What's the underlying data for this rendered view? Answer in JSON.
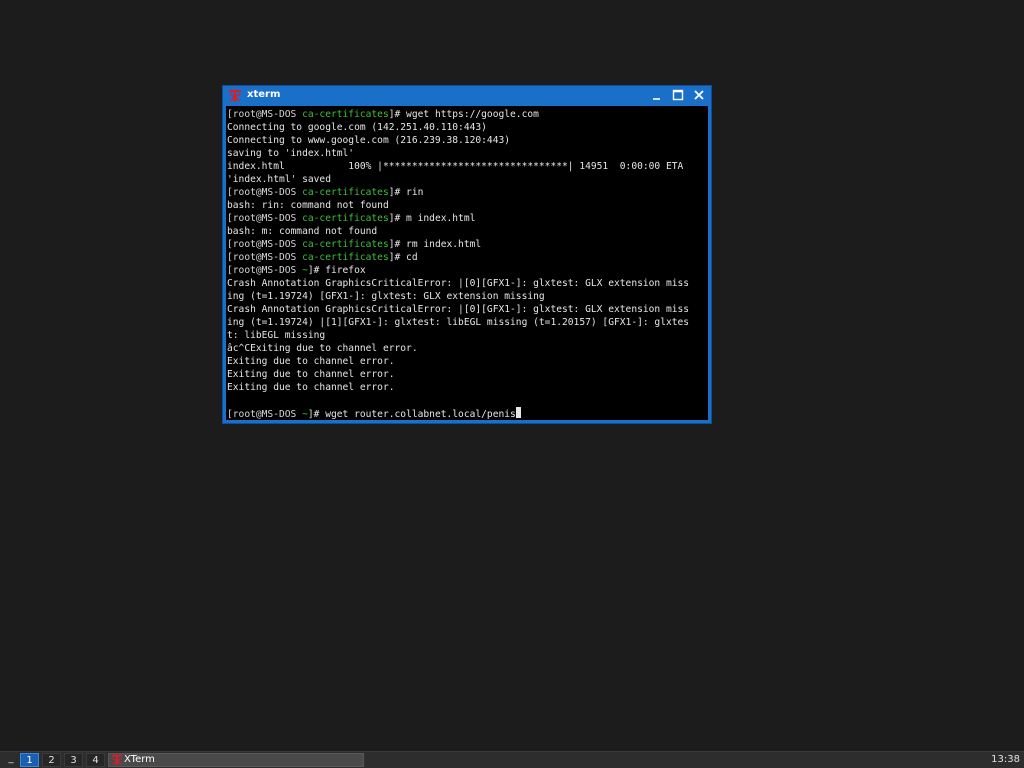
{
  "window": {
    "title": "xterm",
    "icon": "xterm-icon",
    "controls": [
      "minimize-icon",
      "maximize-icon",
      "close-icon"
    ]
  },
  "terminal": {
    "lines": [
      {
        "user": "[root@MS-DOS ",
        "dir": "ca-certificates",
        "rest": "]# wget https://google.com"
      },
      {
        "text": "Connecting to google.com (142.251.40.110:443)"
      },
      {
        "text": "Connecting to www.google.com (216.239.38.120:443)"
      },
      {
        "text": "saving to 'index.html'"
      },
      {
        "text": "index.html           100% |********************************| 14951  0:00:00 ETA"
      },
      {
        "text": "'index.html' saved"
      },
      {
        "user": "[root@MS-DOS ",
        "dir": "ca-certificates",
        "rest": "]# rin"
      },
      {
        "text": "bash: rin: command not found"
      },
      {
        "user": "[root@MS-DOS ",
        "dir": "ca-certificates",
        "rest": "]# m index.html"
      },
      {
        "text": "bash: m: command not found"
      },
      {
        "user": "[root@MS-DOS ",
        "dir": "ca-certificates",
        "rest": "]# rm index.html"
      },
      {
        "user": "[root@MS-DOS ",
        "dir": "ca-certificates",
        "rest": "]# cd"
      },
      {
        "user": "[root@MS-DOS ",
        "dir": "~",
        "rest": "]# firefox"
      },
      {
        "text": "Crash Annotation GraphicsCriticalError: |[0][GFX1-]: glxtest: GLX extension miss"
      },
      {
        "text": "ing (t=1.19724) [GFX1-]: glxtest: GLX extension missing"
      },
      {
        "text": "Crash Annotation GraphicsCriticalError: |[0][GFX1-]: glxtest: GLX extension miss"
      },
      {
        "text": "ing (t=1.19724) |[1][GFX1-]: glxtest: libEGL missing (t=1.20157) [GFX1-]: glxtes"
      },
      {
        "text": "t: libEGL missing"
      },
      {
        "text": "âc^CExiting due to channel error."
      },
      {
        "text": "Exiting due to channel error."
      },
      {
        "text": "Exiting due to channel error."
      },
      {
        "text": "Exiting due to channel error."
      },
      {
        "text": ""
      },
      {
        "user": "[root@MS-DOS ",
        "dir": "~",
        "rest": "]# wget router.collabnet.local/penis",
        "cursor": true
      }
    ]
  },
  "taskbar": {
    "show_desktop_label": "_",
    "desktops": [
      {
        "label": "1",
        "active": true
      },
      {
        "label": "2",
        "active": false
      },
      {
        "label": "3",
        "active": false
      },
      {
        "label": "4",
        "active": false
      }
    ],
    "task": {
      "label": "XTerm",
      "icon": "xterm-icon"
    },
    "clock": "13:38"
  },
  "colors": {
    "desktop_bg": "#1c1c1c",
    "titlebar": "#1a6fc9",
    "prompt_dir": "#3bbf3b",
    "terminal_bg": "#000000",
    "terminal_fg": "#e6e6e6"
  }
}
